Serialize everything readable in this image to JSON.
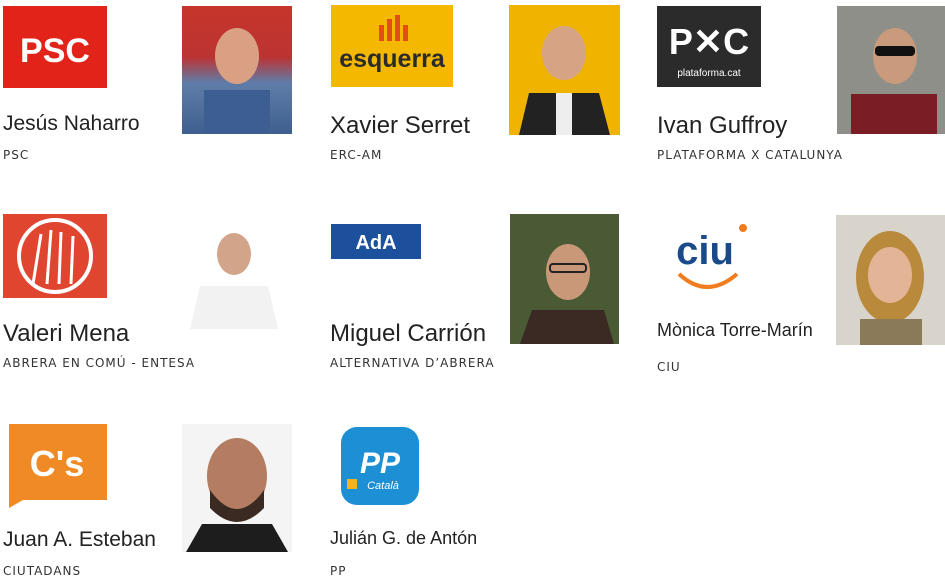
{
  "candidates": [
    {
      "name": "Jesús Naharro",
      "party": "PSC",
      "logo_text": "PSC",
      "logo_color": "#e2231a"
    },
    {
      "name": "Xavier Serret",
      "party": "ERC-AM",
      "logo_text": "esquerra",
      "logo_color": "#f5b800"
    },
    {
      "name": "Ivan Guffroy",
      "party": "PLATAFORMA X CATALUNYA",
      "logo_text": "P✕C",
      "logo_sub": "plataforma.cat",
      "logo_color": "#2b2b2b"
    },
    {
      "name": "Valeri Mena",
      "party": "ABRERA EN COMÚ - ENTESA",
      "logo_color": "#e0452f"
    },
    {
      "name": "Miguel Carrión",
      "party": "ALTERNATIVA D’ABRERA",
      "logo_text": "AdA",
      "logo_color": "#1c4f9c"
    },
    {
      "name": "Mònica Torre-Marín",
      "party": "CIU",
      "logo_text": "ciu",
      "logo_color": "#1a4a8a"
    },
    {
      "name": "Juan A. Esteban",
      "party": "CIUTADANS",
      "logo_text": "C's",
      "logo_color": "#f08a24"
    },
    {
      "name": "Julián G. de Antón",
      "party": "PP",
      "logo_text": "PP",
      "logo_sub": "Català",
      "logo_color": "#1d8fd4"
    }
  ]
}
